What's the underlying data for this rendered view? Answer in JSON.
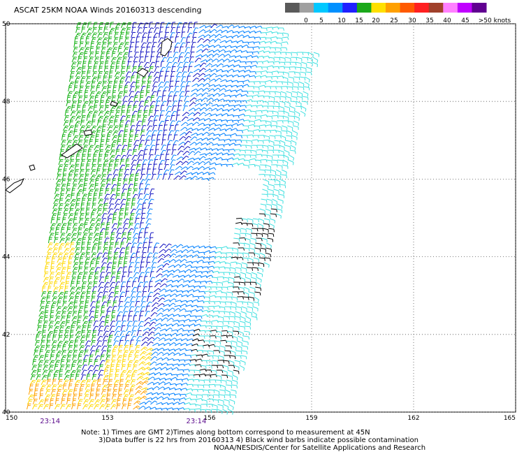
{
  "title": "ASCAT 25KM NOAA Winds 20160313 descending",
  "legend": {
    "labels": [
      "0",
      "5",
      "10",
      "15",
      "20",
      "25",
      "30",
      "35",
      "40",
      "45",
      ">50 knots"
    ],
    "colors": [
      "#5a5a5a",
      "#a0a0a0",
      "#00c8ff",
      "#0090ff",
      "#2020ff",
      "#1aa81a",
      "#ffe000",
      "#ffa000",
      "#ff5a00",
      "#ff2020",
      "#a0402a",
      "#ff80ff",
      "#c000ff",
      "#600090"
    ]
  },
  "map": {
    "lon_ticks": [
      "150",
      "153",
      "156",
      "159",
      "162",
      "165"
    ],
    "lat_ticks": [
      "40",
      "42",
      "44",
      "46",
      "48",
      "50"
    ],
    "time_labels": [
      {
        "text": "23:14",
        "lon": 151.3
      },
      {
        "text": "23:14",
        "lon": 155.6
      }
    ],
    "colors": {
      "calm": "#40e0e0",
      "light": "#0080ff",
      "moderate": "#1010c0",
      "fresh": "#10b010",
      "strong": "#ffd800",
      "gale": "#ffa000",
      "contamination": "#000000"
    }
  },
  "notes": [
    "Note: 1) Times are GMT 2)Times along bottom correspond to measurement at 45N",
    "3)Data buffer is 22 hrs from 20160313 4) Black wind barbs indicate possible contamination",
    "NOAA/NESDIS/Center for Satellite Applications and Research"
  ]
}
